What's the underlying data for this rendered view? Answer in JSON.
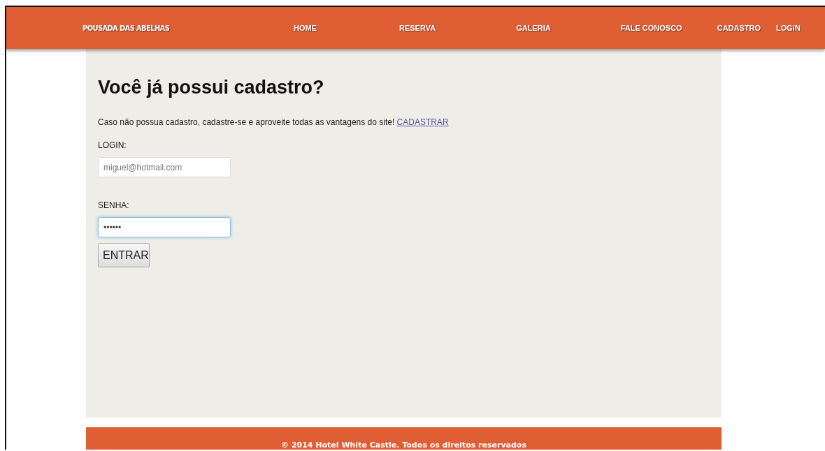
{
  "header": {
    "logo": "POUSADA DAS ABELHAS",
    "nav": [
      {
        "label": "HOME",
        "selected": false
      },
      {
        "label": "RESERVA",
        "selected": false
      },
      {
        "label": "GALERIA",
        "selected": false
      },
      {
        "label": "FALE CONOSCO",
        "selected": false
      },
      {
        "label": "CADASTRO",
        "selected": false
      },
      {
        "label": "LOGIN",
        "selected": false
      }
    ]
  },
  "main": {
    "title": "Você já possui cadastro?",
    "intro": "Caso não possua cadastro, cadastre-se e aproveite todas as vantagens do site!",
    "intro_link": "CADASTRAR",
    "fields": [
      {
        "label": "LOGIN:",
        "placeholder": "miguel@hotmail.com",
        "focused": false
      },
      {
        "label": "SENHA:",
        "value": "••••••",
        "focused": true
      }
    ],
    "button": "ENTRAR"
  },
  "footer": {
    "text": "© 2014 Hotel White Castle. Todos os direitos reservados"
  }
}
